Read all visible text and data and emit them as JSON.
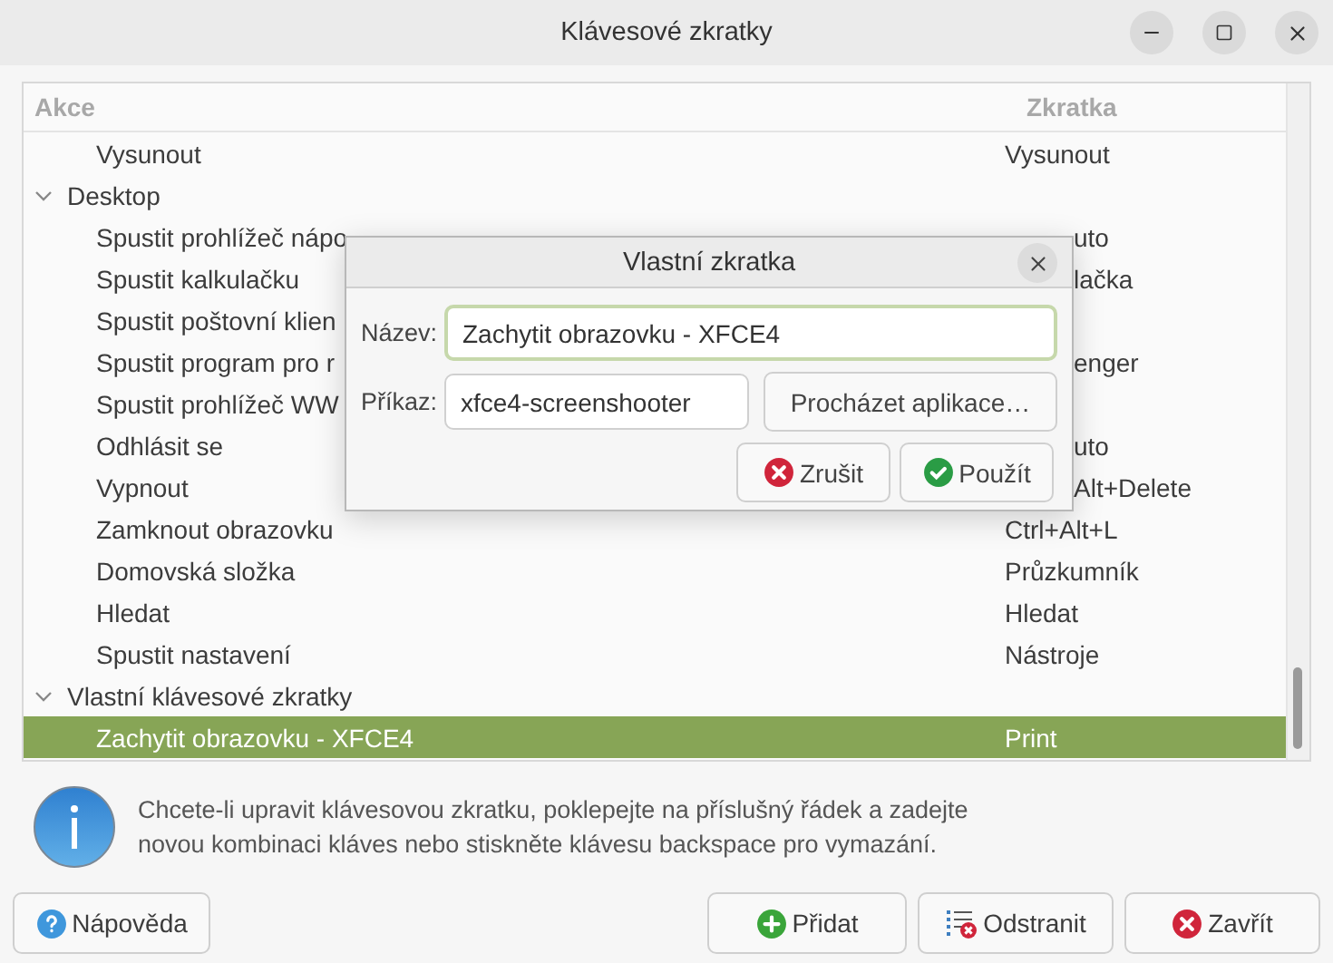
{
  "window": {
    "title": "Klávesové zkratky"
  },
  "table": {
    "columns": [
      "Akce",
      "Zkratka"
    ],
    "rows": [
      {
        "kind": "item",
        "action": "Vysunout",
        "shortcut": "Vysunout",
        "selected": false
      },
      {
        "kind": "group",
        "label": "Desktop",
        "expanded": true,
        "children": [
          {
            "kind": "covered",
            "action": "Spustit prohlížeč nápo",
            "shortcut": "uto",
            "selected": false
          },
          {
            "kind": "covered",
            "action": "Spustit kalkulačku",
            "shortcut": "lačka",
            "selected": false
          },
          {
            "kind": "covered",
            "action": "Spustit poštovní klien",
            "selected": false
          },
          {
            "kind": "covered",
            "action": "Spustit program pro r",
            "shortcut": "enger",
            "selected": false
          },
          {
            "kind": "covered",
            "action": "Spustit prohlížeč WW",
            "selected": false
          },
          {
            "kind": "covered",
            "action": "Odhlásit se",
            "shortcut": "uto",
            "selected": false
          },
          {
            "kind": "covered",
            "action": "Vypnout",
            "shortcut": "Alt+Delete",
            "selected": false
          },
          {
            "kind": "item",
            "action": "Zamknout obrazovku",
            "shortcut": "Ctrl+Alt+L",
            "selected": false
          },
          {
            "kind": "item",
            "action": "Domovská složka",
            "shortcut": "Průzkumník",
            "selected": false
          },
          {
            "kind": "item",
            "action": "Hledat",
            "shortcut": "Hledat",
            "selected": false
          },
          {
            "kind": "item",
            "action": "Spustit nastavení",
            "shortcut": "Nástroje",
            "selected": false
          }
        ]
      },
      {
        "kind": "group",
        "label": "Vlastní klávesové zkratky",
        "expanded": true,
        "children": [
          {
            "kind": "item",
            "action": "Zachytit obrazovku - XFCE4",
            "shortcut": "Print",
            "selected": true
          }
        ]
      }
    ]
  },
  "info": "Chcete-li upravit klávesovou zkratku, poklepejte na příslušný řádek a zadejte\nnovou kombinaci kláves nebo stiskněte klávesu backspace pro vymazání.",
  "buttons": [
    {
      "kind": "help",
      "label": "Nápověda"
    },
    {
      "kind": "add",
      "label": "Přidat"
    },
    {
      "kind": "remove",
      "label": "Odstranit"
    },
    {
      "kind": "close",
      "label": "Zavřít"
    }
  ],
  "dialog": {
    "title": "Vlastní zkratka",
    "name_label": "Název:",
    "name_value": "Zachytit obrazovku - XFCE4",
    "command_label": "Příkaz:",
    "command_value": "xfce4-screenshooter",
    "browse": "Procházet aplikace…",
    "buttons": [
      {
        "kind": "cancel",
        "label": "Zrušit"
      },
      {
        "kind": "apply",
        "label": "Použít"
      }
    ]
  }
}
